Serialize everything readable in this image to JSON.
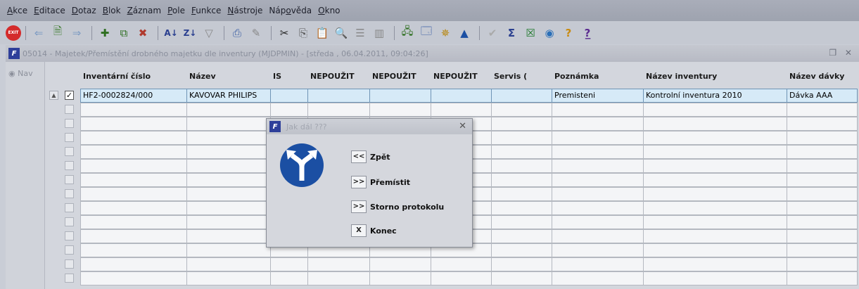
{
  "menu": [
    {
      "pre": "",
      "u": "A",
      "post": "kce"
    },
    {
      "pre": "",
      "u": "E",
      "post": "ditace"
    },
    {
      "pre": "",
      "u": "D",
      "post": "otaz"
    },
    {
      "pre": "",
      "u": "B",
      "post": "lok"
    },
    {
      "pre": "",
      "u": "Z",
      "post": "áznam"
    },
    {
      "pre": "",
      "u": "P",
      "post": "ole"
    },
    {
      "pre": "",
      "u": "F",
      "post": "unkce"
    },
    {
      "pre": "",
      "u": "N",
      "post": "ástroje"
    },
    {
      "pre": "Náp",
      "u": "o",
      "post": "věda"
    },
    {
      "pre": "",
      "u": "O",
      "post": "kno"
    }
  ],
  "toolbar": {
    "exit_label": "EXIT"
  },
  "window": {
    "title": "05014 - Majetek/Přemístění drobného majetku dle inventury (MJDPMIN) - [středa , 06.04.2011, 09:04:26]",
    "controls": "❐ ✕"
  },
  "nav": {
    "label": "Nav"
  },
  "columns": [
    "Inventární číslo",
    "Název",
    "IS",
    "NEPOUŽIT",
    "NEPOUŽIT",
    "NEPOUŽIT",
    "Servis (",
    "Poznámka",
    "Název inventury",
    "Název dávky"
  ],
  "rows": [
    {
      "selected": true,
      "cells": [
        "HF2-0002824/000",
        "KAVOVAR PHILIPS",
        "",
        "",
        "",
        "",
        "",
        "Premisteni",
        "Kontrolní inventura 2010",
        "Dávka AAA"
      ]
    }
  ],
  "dialog": {
    "title": "Jak dál ???",
    "buttons": [
      {
        "key": "<<",
        "label": "Zpět"
      },
      {
        "key": ">>",
        "label": "Přemístit"
      },
      {
        "key": ">>",
        "label": "Storno protokolu"
      },
      {
        "key": "X",
        "label": "Konec"
      }
    ],
    "sign_color": "#1b4fa3"
  }
}
